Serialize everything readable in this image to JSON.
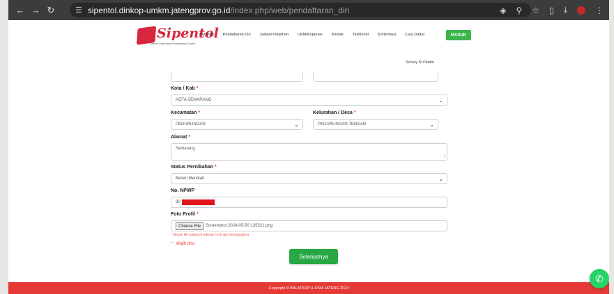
{
  "browser": {
    "url_host": "sipentol.dinkop-umkm.jatengprov.go.id",
    "url_path": "/index.php/web/pendaftaran_diri"
  },
  "header": {
    "logo_text": "Sipentol",
    "logo_sub": "Sistem Informasi Pendaftaran Online",
    "menu": [
      "Beranda",
      "Pendaftaran Diri",
      "Jadwal Pelatihan",
      "UKM/Koperasi",
      "Kontak",
      "Testimoni",
      "Konfirmasi",
      "Cara Daftar"
    ],
    "login_label": "MASUK",
    "survey_link": "Survey Si Pentol"
  },
  "form": {
    "kota_label": "Kota / Kab",
    "kota_value": "KOTA SEMARANG",
    "kecamatan_label": "Kecamatan",
    "kecamatan_value": "PEDURUNGAN",
    "kelurahan_label": "Kelurahan / Desa",
    "kelurahan_value": "PEDURUNGAN TENGAH",
    "alamat_label": "Alamat",
    "alamat_value": "Semarang",
    "status_label": "Status Pernikahan",
    "status_value": "Belum Menikah",
    "npwp_label": "No. NPWP",
    "npwp_value": "90",
    "foto_label": "Foto Profil",
    "choose_file_label": "Choose File",
    "file_name": "Screenshot 2024-05-30 135321.png",
    "foto_hint": "* Ukuran file maksimal sebesar 3 mb dan format jpg/png",
    "required_mark": "*",
    "wajib_note": "* : Wajib diisi",
    "next_label": "Selanjutnya"
  },
  "footer": {
    "copyright": "Copyright © BALATKOP & UKM JATENG 2024"
  },
  "colors": {
    "accent_red": "#e53935",
    "green": "#28a745",
    "whatsapp": "#25d366"
  }
}
